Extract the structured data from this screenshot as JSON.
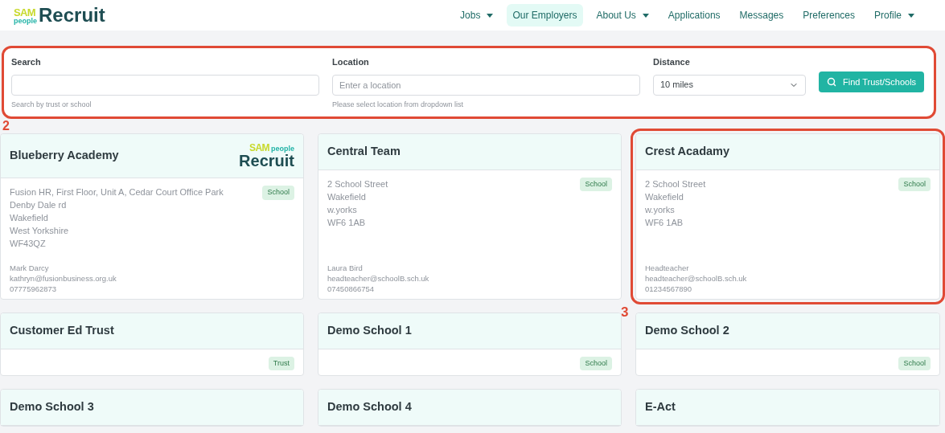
{
  "logo": {
    "mark": "SAM",
    "sub": "people",
    "name": "Recruit"
  },
  "nav": [
    {
      "label": "Jobs",
      "has_menu": true,
      "selected": false
    },
    {
      "label": "Our Employers",
      "has_menu": false,
      "selected": true
    },
    {
      "label": "About Us",
      "has_menu": true,
      "selected": false
    },
    {
      "label": "Applications",
      "has_menu": false,
      "selected": false
    },
    {
      "label": "Messages",
      "has_menu": false,
      "selected": false
    },
    {
      "label": "Preferences",
      "has_menu": false,
      "selected": false
    },
    {
      "label": "Profile",
      "has_menu": true,
      "selected": false
    }
  ],
  "search_panel": {
    "highlighted": true,
    "search": {
      "label": "Search",
      "hint": "Search by trust or school"
    },
    "location": {
      "label": "Location",
      "placeholder": "Enter a location",
      "hint": "Please select location from dropdown list"
    },
    "distance": {
      "label": "Distance",
      "value": "10 miles"
    },
    "button": "Find Trust/Schools"
  },
  "grid_callout": "2",
  "employers": [
    {
      "name": "Blueberry Academy",
      "logo": {
        "mark": "SAM",
        "sub": "people",
        "name": "Recruit"
      },
      "highlighted": false,
      "type": "School",
      "address": [
        "Fusion HR, First Floor, Unit A, Cedar Court Office Park",
        "Denby Dale rd",
        "Wakefield",
        "West Yorkshire",
        "WF43QZ"
      ],
      "contact": [
        "Mark Darcy",
        "kathryn@fusionbusiness.org.uk",
        "07775962873"
      ]
    },
    {
      "name": "Central Team",
      "highlighted": false,
      "type": "School",
      "address": [
        "2 School Street",
        "Wakefield",
        "w.yorks",
        "WF6 1AB"
      ],
      "contact": [
        "Laura Bird",
        "headteacher@schoolB.sch.uk",
        "07450866754"
      ]
    },
    {
      "name": "Crest Acadamy",
      "highlighted": true,
      "callout": "3",
      "type": "School",
      "address": [
        "2 School Street",
        "Wakefield",
        "w.yorks",
        "WF6 1AB"
      ],
      "contact": [
        "Headteacher",
        "headteacher@schoolB.sch.uk",
        "01234567890"
      ]
    },
    {
      "name": "Customer Ed Trust",
      "highlighted": false,
      "type": "Trust"
    },
    {
      "name": "Demo School 1",
      "highlighted": false,
      "type": "School"
    },
    {
      "name": "Demo School 2",
      "highlighted": false,
      "type": "School"
    },
    {
      "name": "Demo School 3",
      "highlighted": false
    },
    {
      "name": "Demo School 4",
      "highlighted": false
    },
    {
      "name": "E-Act",
      "highlighted": false
    }
  ]
}
